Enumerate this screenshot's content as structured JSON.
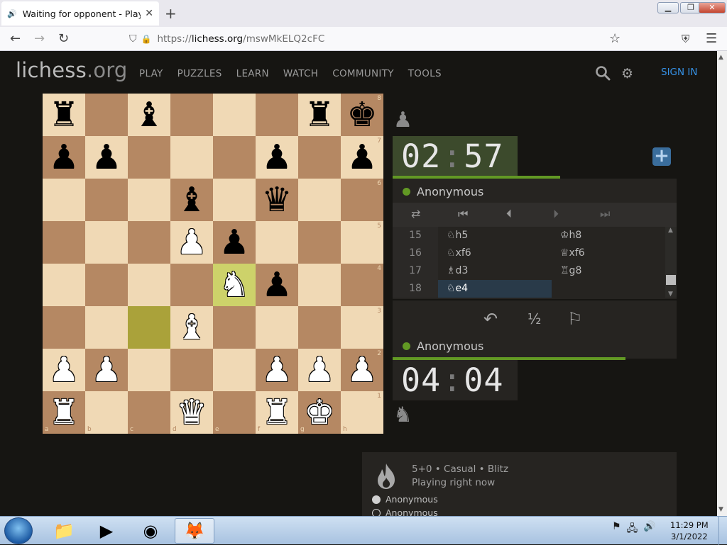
{
  "browser": {
    "tab_title": "Waiting for opponent - Play An",
    "tab_icon": "speaker-icon",
    "url_scheme": "https://",
    "url_host": "lichess.org",
    "url_path": "/mswMkELQ2cFC"
  },
  "site": {
    "logo_main": "lichess",
    "logo_suffix": ".org",
    "nav": [
      "PLAY",
      "PUZZLES",
      "LEARN",
      "WATCH",
      "COMMUNITY",
      "TOOLS"
    ],
    "signin": "SIGN IN"
  },
  "board": {
    "ranks": [
      [
        "br",
        "",
        "bb",
        "",
        "",
        "",
        "br",
        "bk"
      ],
      [
        "bp",
        "bp",
        "",
        "",
        "",
        "bp",
        "",
        "bp"
      ],
      [
        "",
        "",
        "",
        "bb",
        "",
        "bq",
        "",
        ""
      ],
      [
        "",
        "",
        "",
        "wp",
        "bp",
        "",
        "",
        ""
      ],
      [
        "",
        "",
        "",
        "",
        "wn",
        "bp",
        "",
        ""
      ],
      [
        "",
        "",
        "",
        "wb",
        "",
        "",
        "",
        ""
      ],
      [
        "wp",
        "wp",
        "",
        "",
        "",
        "wp",
        "wp",
        "wp"
      ],
      [
        "wr",
        "",
        "",
        "wq",
        "",
        "wr",
        "wk",
        ""
      ]
    ],
    "highlight_squares": [
      "e4",
      "c3"
    ],
    "rank_labels": [
      "8",
      "7",
      "6",
      "5",
      "4",
      "3",
      "2",
      "1"
    ],
    "file_labels": [
      "a",
      "b",
      "c",
      "d",
      "e",
      "f",
      "g",
      "h"
    ]
  },
  "game": {
    "top_clock_min": "02",
    "top_clock_sec": "57",
    "bottom_clock_min": "04",
    "bottom_clock_sec": "04",
    "top_time_fraction": 0.59,
    "bottom_time_fraction": 0.82,
    "top_player": "Anonymous",
    "bottom_player": "Anonymous",
    "moves": [
      {
        "num": "15",
        "white": "♘h5",
        "black": "♔h8"
      },
      {
        "num": "16",
        "white": "♘xf6",
        "black": "♕xf6"
      },
      {
        "num": "17",
        "white": "♗d3",
        "black": "♖g8"
      },
      {
        "num": "18",
        "white": "♘e4",
        "black": ""
      }
    ],
    "draw_label": "½"
  },
  "info": {
    "meta": "5+0 • Casual • Blitz",
    "status": "Playing right now",
    "players": [
      "Anonymous",
      "Anonymous"
    ]
  },
  "taskbar": {
    "time": "11:29 PM",
    "date": "3/1/2022"
  }
}
